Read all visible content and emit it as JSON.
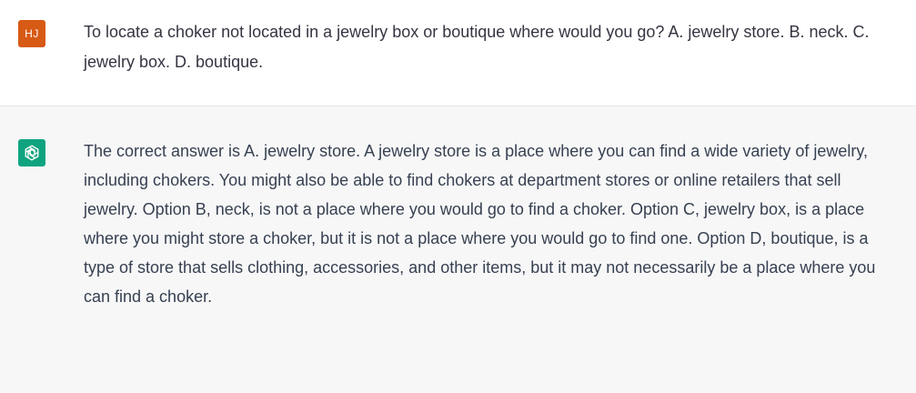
{
  "conversation": {
    "user_message": {
      "avatar_initials": "HJ",
      "avatar_color": "#d75a15",
      "text": "To locate a choker not located in a jewelry box or boutique where would you go?  A. jewelry store. B. neck. C. jewelry box. D. boutique."
    },
    "assistant_message": {
      "avatar_icon": "openai-logo-icon",
      "avatar_color": "#10a37f",
      "text": "The correct answer is A. jewelry store. A jewelry store is a place where you can find a wide variety of jewelry, including chokers. You might also be able to find chokers at department stores or online retailers that sell jewelry. Option B, neck, is not a place where you would go to find a choker. Option C, jewelry box, is a place where you might store a choker, but it is not a place where you would go to find one. Option D, boutique, is a type of store that sells clothing, accessories, and other items, but it may not necessarily be a place where you can find a choker."
    }
  }
}
